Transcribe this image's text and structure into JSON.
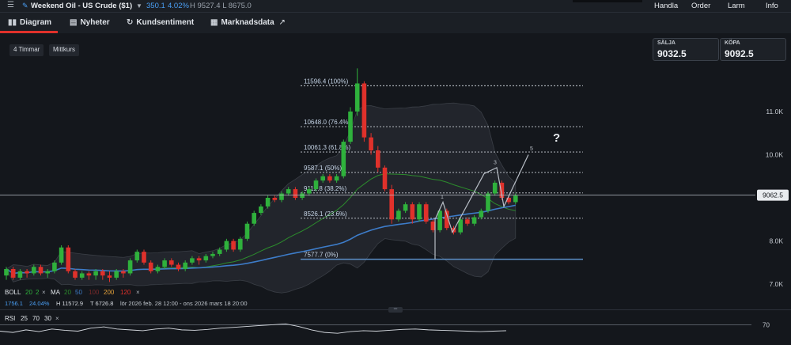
{
  "topbar": {
    "instrument_title": "Weekend Oil - US Crude ($1)",
    "price": "350.1",
    "change_pct": "4.02%",
    "high_low": "H 9527.4  L 8675.0",
    "nav": [
      "Handla",
      "Order",
      "Larm",
      "Info"
    ]
  },
  "tabs": [
    {
      "label": "Diagram",
      "icon": "chart-bars-icon"
    },
    {
      "label": "Nyheter",
      "icon": "newspaper-icon"
    },
    {
      "label": "Kundsentiment",
      "icon": "refresh-icon"
    },
    {
      "label": "Marknadsdata",
      "icon": "building-icon",
      "external": "↗"
    }
  ],
  "toolbar": {
    "interval": "4 Timmar",
    "price_type": "Mittkurs"
  },
  "trade": {
    "sell_label": "SÄLJA",
    "sell_value": "9032.5",
    "buy_label": "KÖPA",
    "buy_value": "9092.5"
  },
  "colors": {
    "up": "#2fb13c",
    "down": "#e0312b",
    "accent": "#4a9ff5",
    "ma_fast": "#2c8c2c",
    "ma_slow": "#3d7cc9"
  },
  "chart_data": {
    "type": "candlestick",
    "ylim": [
      6800,
      12300
    ],
    "y_ticks": [
      "11.0K",
      "10.0K",
      "9.0K",
      "8.0K",
      "7.0K"
    ],
    "y_tick_values": [
      11000,
      10000,
      9000,
      8000,
      7000
    ],
    "current_price_label": "9062.5",
    "current_price": 9062.5,
    "fib_levels": [
      {
        "label": "11596.4 (100%)",
        "value": 11596.4
      },
      {
        "label": "10648.0 (76.4%)",
        "value": 10648.0
      },
      {
        "label": "10061.3 (61.8%)",
        "value": 10061.3
      },
      {
        "label": "9587.1 (50%)",
        "value": 9587.1
      },
      {
        "label": "9112.8 (38.2%)",
        "value": 9112.8
      },
      {
        "label": "8526.1 (23.6%)",
        "value": 8526.1
      },
      {
        "label": "7577.7 (0%)",
        "value": 7577.7
      }
    ],
    "wave_labels": [
      "1",
      "3",
      "5",
      "?"
    ],
    "candles": [
      [
        7200,
        7350,
        7100,
        7400
      ],
      [
        7350,
        7150,
        7100,
        7400
      ],
      [
        7150,
        7300,
        7100,
        7350
      ],
      [
        7300,
        7250,
        7150,
        7350
      ],
      [
        7250,
        7400,
        7200,
        7450
      ],
      [
        7400,
        7250,
        7200,
        7450
      ],
      [
        7250,
        7300,
        7150,
        7350
      ],
      [
        7300,
        7500,
        7250,
        7550
      ],
      [
        7500,
        7850,
        7450,
        7900
      ],
      [
        7850,
        7300,
        7250,
        7900
      ],
      [
        7300,
        7150,
        7100,
        7350
      ],
      [
        7150,
        7250,
        7100,
        7300
      ],
      [
        7250,
        7200,
        7100,
        7300
      ],
      [
        7200,
        7300,
        7100,
        7350
      ],
      [
        7300,
        7200,
        7100,
        7350
      ],
      [
        7200,
        7150,
        7050,
        7300
      ],
      [
        7150,
        7300,
        7100,
        7350
      ],
      [
        7300,
        7250,
        7150,
        7350
      ],
      [
        7250,
        7550,
        7200,
        7600
      ],
      [
        7550,
        7750,
        7500,
        7800
      ],
      [
        7750,
        7500,
        7450,
        7800
      ],
      [
        7500,
        7300,
        7250,
        7550
      ],
      [
        7300,
        7400,
        7250,
        7450
      ],
      [
        7400,
        7550,
        7350,
        7600
      ],
      [
        7550,
        7450,
        7400,
        7600
      ],
      [
        7450,
        7350,
        7300,
        7500
      ],
      [
        7350,
        7500,
        7300,
        7550
      ],
      [
        7500,
        7600,
        7450,
        7650
      ],
      [
        7600,
        7550,
        7450,
        7650
      ],
      [
        7550,
        7650,
        7500,
        7700
      ],
      [
        7650,
        7700,
        7600,
        7750
      ],
      [
        7700,
        7800,
        7650,
        7850
      ],
      [
        7800,
        8000,
        7750,
        8050
      ],
      [
        8000,
        7800,
        7750,
        8050
      ],
      [
        7800,
        8050,
        7750,
        8100
      ],
      [
        8050,
        8400,
        8000,
        8450
      ],
      [
        8400,
        8650,
        8350,
        8700
      ],
      [
        8650,
        8800,
        8600,
        8850
      ],
      [
        8800,
        9000,
        8750,
        9050
      ],
      [
        9000,
        8950,
        8900,
        9050
      ],
      [
        8950,
        9100,
        8900,
        9150
      ],
      [
        9100,
        9200,
        9050,
        9250
      ],
      [
        9200,
        9000,
        8950,
        9250
      ],
      [
        9000,
        9100,
        8950,
        9150
      ],
      [
        9100,
        9200,
        9050,
        9250
      ],
      [
        9200,
        9400,
        9150,
        9450
      ],
      [
        9400,
        9500,
        9350,
        9550
      ],
      [
        9500,
        9400,
        9350,
        9550
      ],
      [
        9400,
        9500,
        9350,
        9550
      ],
      [
        9500,
        10300,
        9450,
        10350
      ],
      [
        10300,
        11000,
        10250,
        11100
      ],
      [
        11000,
        11650,
        10900,
        12000
      ],
      [
        11650,
        10400,
        10300,
        11700
      ],
      [
        10400,
        10100,
        10000,
        10500
      ],
      [
        10100,
        9700,
        9600,
        10200
      ],
      [
        9700,
        9200,
        9150,
        9750
      ],
      [
        9200,
        8500,
        8400,
        9300
      ],
      [
        8500,
        8700,
        8450,
        8750
      ],
      [
        8700,
        8850,
        8650,
        8900
      ],
      [
        8850,
        8500,
        8400,
        8900
      ],
      [
        8500,
        8850,
        8450,
        8900
      ],
      [
        8850,
        8450,
        8400,
        8900
      ],
      [
        8450,
        8250,
        8200,
        8500
      ],
      [
        8250,
        8700,
        8200,
        8750
      ],
      [
        8700,
        8300,
        8250,
        8750
      ],
      [
        8300,
        8200,
        8150,
        8350
      ],
      [
        8200,
        8500,
        8150,
        8550
      ],
      [
        8500,
        8400,
        8350,
        8550
      ],
      [
        8400,
        8550,
        8350,
        8600
      ],
      [
        8550,
        8700,
        8500,
        8750
      ],
      [
        8700,
        9100,
        8650,
        9150
      ],
      [
        9100,
        9350,
        9050,
        9400
      ],
      [
        9350,
        9000,
        8950,
        9400
      ],
      [
        9000,
        8900,
        8850,
        9050
      ],
      [
        8900,
        9050,
        8850,
        9100
      ]
    ]
  },
  "indicators": {
    "boll": {
      "label": "BOLL",
      "p1": "20",
      "p2": "2",
      "close": "×"
    },
    "ma": {
      "label": "MA",
      "p1": "20",
      "p2": "50",
      "p3": "100",
      "p4": "200",
      "p5": "120",
      "close": "×"
    },
    "info": {
      "v1": "1756.1",
      "v2": "24.04%",
      "high": "H 11572.9",
      "low": "T 6726.8",
      "range": "lör 2026 feb. 28 12:00 - ons 2026 mars 18 20:00"
    },
    "rsi": {
      "label": "RSI",
      "p1": "25",
      "p2": "70",
      "p3": "30",
      "close": "×",
      "level_label": "70",
      "values": [
        55,
        52,
        58,
        54,
        60,
        57,
        55,
        62,
        65,
        60,
        58,
        56,
        60,
        62,
        58,
        57,
        59,
        62,
        64,
        66,
        68,
        70,
        72,
        66,
        58,
        52,
        50,
        54,
        56,
        55,
        57,
        59,
        60,
        58,
        57,
        56,
        55,
        54,
        55,
        56
      ]
    }
  }
}
